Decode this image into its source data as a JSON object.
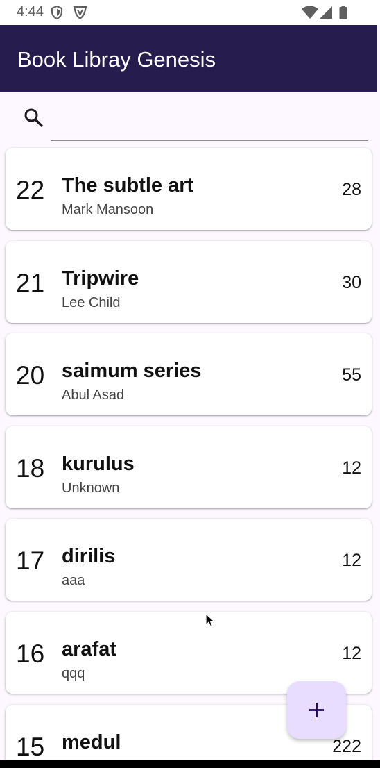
{
  "status_bar": {
    "time": "4:44",
    "left_icons": [
      "shield-icon",
      "vpn-icon"
    ],
    "right_icons": [
      "wifi-icon",
      "signal-icon",
      "battery-icon"
    ]
  },
  "app_bar": {
    "title": "Book Libray Genesis"
  },
  "search": {
    "value": "",
    "placeholder": "",
    "icon": "search-icon"
  },
  "books": [
    {
      "id": "22",
      "title": "The subtle art",
      "author": "Mark Mansoon",
      "pages": "28"
    },
    {
      "id": "21",
      "title": "Tripwire",
      "author": "Lee Child",
      "pages": "30"
    },
    {
      "id": "20",
      "title": "saimum series",
      "author": "Abul Asad",
      "pages": "55"
    },
    {
      "id": "18",
      "title": "kurulus",
      "author": "Unknown",
      "pages": "12"
    },
    {
      "id": "17",
      "title": "dirilis",
      "author": "aaa",
      "pages": "12"
    },
    {
      "id": "16",
      "title": "arafat",
      "author": "qqq",
      "pages": "12"
    },
    {
      "id": "15",
      "title": "medul",
      "author": "",
      "pages": "222"
    }
  ],
  "fab": {
    "icon": "plus-icon"
  },
  "colors": {
    "app_bar": "#261c4e",
    "background": "#fdf7ff",
    "card": "#ffffff",
    "fab": "#e9ddff",
    "fab_icon": "#21005d"
  }
}
